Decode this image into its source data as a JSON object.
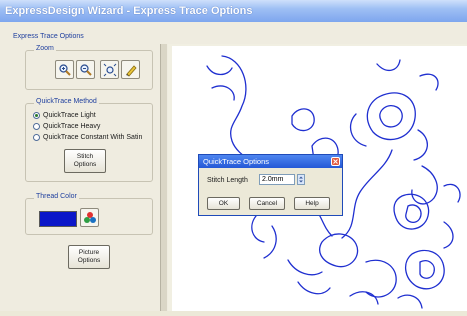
{
  "window": {
    "title": "ExpressDesign Wizard - Express Trace Options"
  },
  "panel": {
    "heading": "Express Trace Options",
    "zoom": {
      "legend": "Zoom",
      "tools": [
        "zoom-in-icon",
        "zoom-out-icon",
        "zoom-fit-icon",
        "pencil-icon"
      ]
    },
    "quicktrace": {
      "legend": "QuickTrace Method",
      "options": [
        {
          "label": "QuickTrace Light",
          "checked": true
        },
        {
          "label": "QuickTrace Heavy",
          "checked": false
        },
        {
          "label": "QuickTrace Constant With Satin",
          "checked": false
        }
      ],
      "stitch_button": "Stitch\nOptions"
    },
    "thread": {
      "legend": "Thread Color",
      "swatch_color": "#0b16c9",
      "palette_icon": "color-palette-icon"
    },
    "picture_button": "Picture\nOptions"
  },
  "dialog": {
    "title": "QuickTrace Options",
    "stitch_length_label": "Stitch Length",
    "stitch_length_value": "2.0",
    "stitch_length_unit": "mm",
    "ok_label": "OK",
    "cancel_label": "Cancel",
    "help_label": "Help"
  },
  "colors": {
    "accent": "#1f3f9e",
    "trace_line": "#1f2fd0"
  }
}
